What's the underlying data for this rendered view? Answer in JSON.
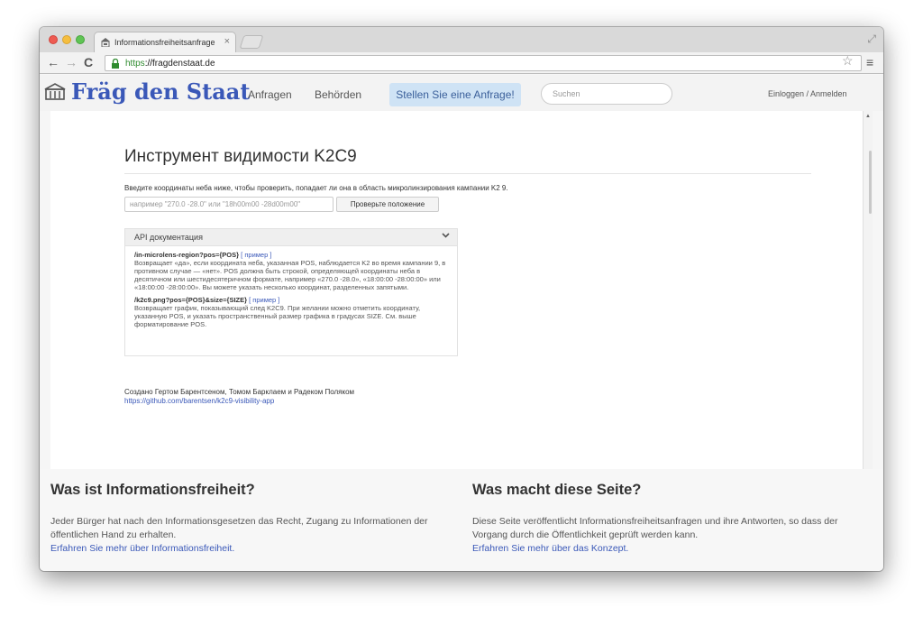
{
  "browser": {
    "tab_title": "Informationsfreiheitsanfrage",
    "url_scheme": "https",
    "url_sep": "://",
    "url_host": "fragdenstaat.de"
  },
  "site_nav": {
    "brand": "Fräg den Staat",
    "links": [
      "Anfragen",
      "Behörden"
    ],
    "cta_label": "Stellen Sie eine Anfrage!",
    "search_placeholder": "Suchen",
    "login_label": "Einloggen / Anmelden"
  },
  "tool": {
    "title": "Инструмент видимости K2C9",
    "instructions": "Введите координаты неба ниже, чтобы проверить, попадает ли она в область микролинзирования кампании K2 9.",
    "input_placeholder": "например \"270.0 -28.0\" или \"18h00m00 -28d00m00\"",
    "check_button": "Проверьте положение",
    "api_panel": {
      "title": "API документация",
      "endpoints": [
        {
          "path": "/in-microlens-region?pos={POS}",
          "example": "[ пример ]",
          "description": "Возвращает «да», если координата неба, указанная POS, наблюдается K2 во время кампании 9, в противном случае — «нет». POS должна быть строкой, определяющей координаты неба в десятичном или шестидесятеричном формате, например «270.0 -28.0», «18:00:00 -28:00:00» или «18:00:00 -28:00:00». Вы можете указать несколько координат, разделенных запятыми."
        },
        {
          "path": "/k2c9.png?pos={POS}&size={SIZE}",
          "example": "[ пример ]",
          "description": "Возвращает график, показывающий след K2C9. При желании можно отметить координату, указанную POS, и указать пространственный размер графика в градусах SIZE. См. выше форматирование POS."
        }
      ]
    },
    "credit": "Создано Гертом Барентсеном, Томом Барклаем и Радеком Поляком",
    "credit_link": "https://github.com/barentsen/k2c9-visibility-app"
  },
  "footer": {
    "left": {
      "heading": "Was ist Informationsfreiheit?",
      "text": "Jeder Bürger hat nach den Informationsgesetzen das Recht, Zugang zu Informationen der öffentlichen Hand zu erhalten.",
      "link": "Erfahren Sie mehr über Informationsfreiheit."
    },
    "right": {
      "heading": "Was macht diese Seite?",
      "text": "Diese Seite veröffentlicht Informationsfreiheitsanfragen und ihre Antworten, so dass der Vorgang durch die Öffentlichkeit geprüft werden kann.",
      "link": "Erfahren Sie mehr über das Konzept."
    }
  }
}
